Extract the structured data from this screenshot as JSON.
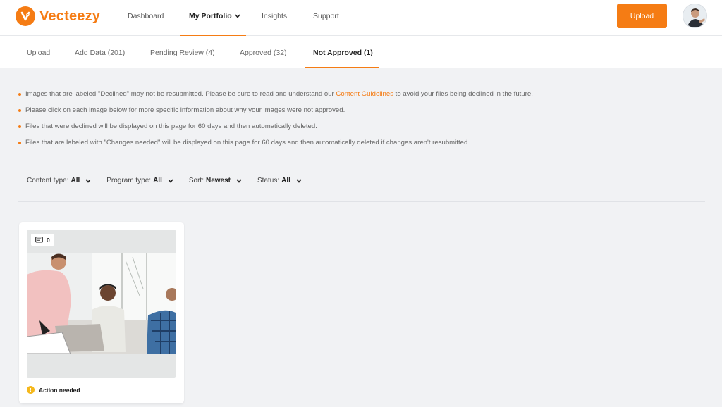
{
  "brand": {
    "name": "Vecteezy",
    "accent": "#f57c14"
  },
  "nav": {
    "items": [
      {
        "label": "Dashboard"
      },
      {
        "label": "My Portfolio"
      },
      {
        "label": "Insights"
      },
      {
        "label": "Support"
      }
    ],
    "upload_label": "Upload"
  },
  "subtabs": [
    {
      "label": "Upload"
    },
    {
      "label": "Add Data (201)"
    },
    {
      "label": "Pending Review (4)"
    },
    {
      "label": "Approved (32)"
    },
    {
      "label": "Not Approved (1)"
    }
  ],
  "notes": {
    "n1_before": "Images that are labeled \"Declined\" may not be resubmitted. Please be sure to read and understand our ",
    "n1_link": "Content Guidelines",
    "n1_after": " to avoid your files being declined in the future.",
    "n2": "Please click on each image below for more specific information about why your images were not approved.",
    "n3": "Files that were declined will be displayed on this page for 60 days and then automatically deleted.",
    "n4": "Files that are labeled with \"Changes needed\" will be displayed on this page for 60 days and then automatically deleted if changes aren't resubmitted."
  },
  "filters": [
    {
      "label": "Content type:",
      "value": "All"
    },
    {
      "label": "Program type:",
      "value": "All"
    },
    {
      "label": "Sort:",
      "value": "Newest"
    },
    {
      "label": "Status:",
      "value": "All"
    }
  ],
  "card": {
    "comment_count": "0",
    "status_label": "Action needed",
    "status_icon": "!",
    "status_color": "#f5b81c"
  }
}
